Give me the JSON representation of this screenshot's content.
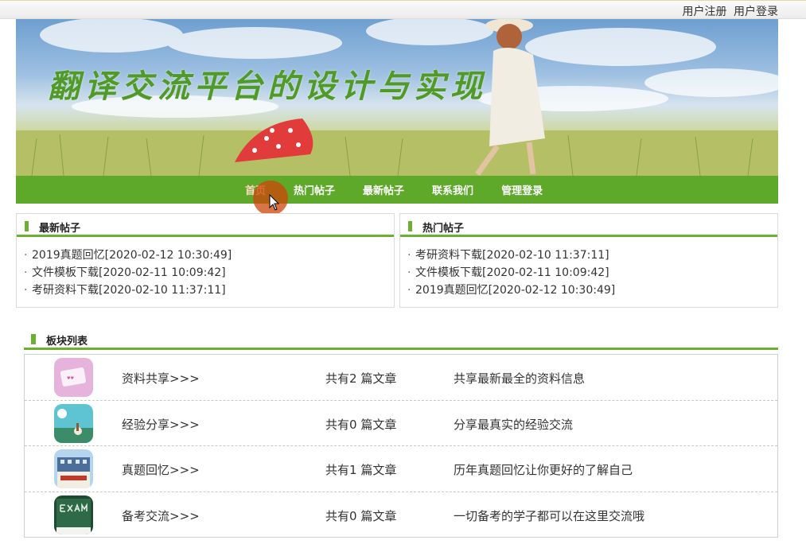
{
  "topbar": {
    "register": "用户注册",
    "login": "用户登录"
  },
  "banner": {
    "title": "翻译交流平台的设计与实现"
  },
  "nav": {
    "items": [
      "首页",
      "热门帖子",
      "最新帖子",
      "联系我们",
      "管理登录"
    ],
    "active": "首页"
  },
  "latest": {
    "title": "最新帖子",
    "items": [
      "2019真题回忆[2020-02-12 10:30:49]",
      "文件模板下载[2020-02-11 10:09:42]",
      "考研资料下载[2020-02-10 11:37:11]"
    ]
  },
  "hot": {
    "title": "热门帖子",
    "items": [
      "考研资料下载[2020-02-10 11:37:11]",
      "文件模板下载[2020-02-11 10:09:42]",
      "2019真题回忆[2020-02-12 10:30:49]"
    ]
  },
  "boards": {
    "title": "板块列表",
    "count_prefix": "共有",
    "count_suffix": " 篇文章",
    "rows": [
      {
        "name": "资料共享>>>",
        "count": 2,
        "desc": "共享最新最全的资料信息",
        "icon": "card-photo-icon"
      },
      {
        "name": "经验分享>>>",
        "count": 0,
        "desc": "分享最真实的经验交流",
        "icon": "landscape-icon"
      },
      {
        "name": "真题回忆>>>",
        "count": 1,
        "desc": "历年真题回忆让你更好的了解自己",
        "icon": "building-icon"
      },
      {
        "name": "备考交流>>>",
        "count": 0,
        "desc": "一切备考的学子都可以在这里交流哦",
        "icon": "chalkboard-exam-icon"
      }
    ]
  },
  "colors": {
    "accent": "#5ea82a",
    "title_green": "#4f9a2a"
  }
}
